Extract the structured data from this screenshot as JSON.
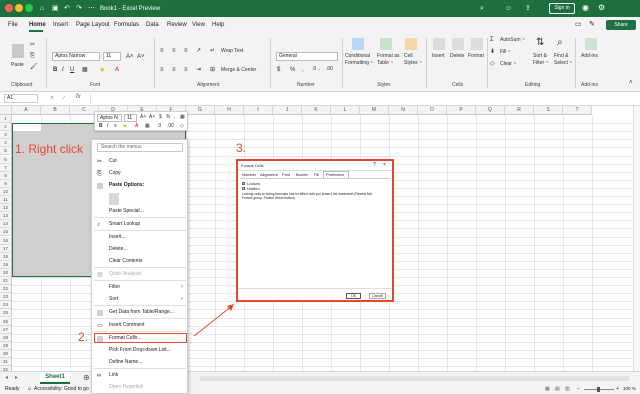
{
  "window": {
    "title": "Book1 - Excel Preview",
    "search_placeholder": "Search",
    "signin_label": "Sign in",
    "share_label": "Share"
  },
  "menu": [
    "File",
    "Home",
    "Insert",
    "Page Layout",
    "Formulas",
    "Data",
    "Review",
    "View",
    "Help"
  ],
  "ribbon": {
    "paste": "Paste",
    "font_name": "Aptos Narrow",
    "font_size": "11",
    "wrap_text": "Wrap Text",
    "merge_center": "Merge & Center",
    "number_format": "General",
    "cond_format": [
      "Conditional",
      "Formatting ~"
    ],
    "format_table": [
      "Format as",
      "Table ~"
    ],
    "cell_styles": [
      "Cell",
      "Styles ~"
    ],
    "insert": "Insert",
    "delete": "Delete",
    "format": "Format",
    "autosum": "AutoSum ~",
    "fill": "Fill ~",
    "clear": "Clear ~",
    "sort_filter": [
      "Sort &",
      "Filter ~"
    ],
    "find_select": [
      "Find &",
      "Select ~"
    ],
    "addins": "Add-ins",
    "groups": [
      "Clipboard",
      "Font",
      "Alignment",
      "Number",
      "Styles",
      "Cells",
      "Editing",
      "Add-ins"
    ]
  },
  "formula_bar": {
    "cell_ref": "A1",
    "fx": "fx"
  },
  "columns": [
    "A",
    "B",
    "C",
    "D",
    "E",
    "F",
    "G",
    "H",
    "I",
    "J",
    "K",
    "L",
    "M",
    "N",
    "O",
    "P",
    "Q",
    "R",
    "S",
    "T"
  ],
  "rows": [
    "1",
    "2",
    "3",
    "4",
    "5",
    "6",
    "7",
    "8",
    "9",
    "10",
    "11",
    "12",
    "13",
    "14",
    "15",
    "16",
    "17",
    "18",
    "19",
    "20",
    "21",
    "22",
    "23",
    "24",
    "25",
    "26",
    "27",
    "28",
    "29",
    "30",
    "31",
    "32"
  ],
  "mini_toolbar": {
    "font": "Aptos N",
    "size": "11"
  },
  "context_menu": {
    "search_placeholder": "Search the menus",
    "items": [
      "Cut",
      "Copy",
      "Paste Options:",
      "Paste Special...",
      "Smart Lookup",
      "Insert...",
      "Delete...",
      "Clear Contents",
      "Quick Analysis",
      "Filter",
      "Sort",
      "Get Data from Table/Range...",
      "Insert Comment",
      "Format Cells...",
      "Pick From Drop-down List...",
      "Define Name...",
      "Link",
      "Open Hyperlink"
    ]
  },
  "dialog": {
    "title": "Format Cells",
    "help": "?",
    "close": "×",
    "tabs": [
      "Number",
      "Alignment",
      "Font",
      "Border",
      "Fill",
      "Protection"
    ],
    "locked": "Locked",
    "hidden": "Hidden",
    "note": [
      "Locking cells or hiding formulas has no effect until you protect the worksheet (Review tab,",
      "Protect group, Protect Sheet button)."
    ],
    "ok": "OK",
    "cancel": "Cancel"
  },
  "annotations": {
    "step1": "1. Right click",
    "step2": "2.",
    "step3": "3."
  },
  "sheet_tab": "Sheet1",
  "status": {
    "ready": "Ready",
    "accessibility": "Accessibility: Good to go",
    "zoom": "100 %"
  },
  "colors": {
    "excel_green": "#1d6f3e",
    "annotation_red": "#e8472f"
  }
}
